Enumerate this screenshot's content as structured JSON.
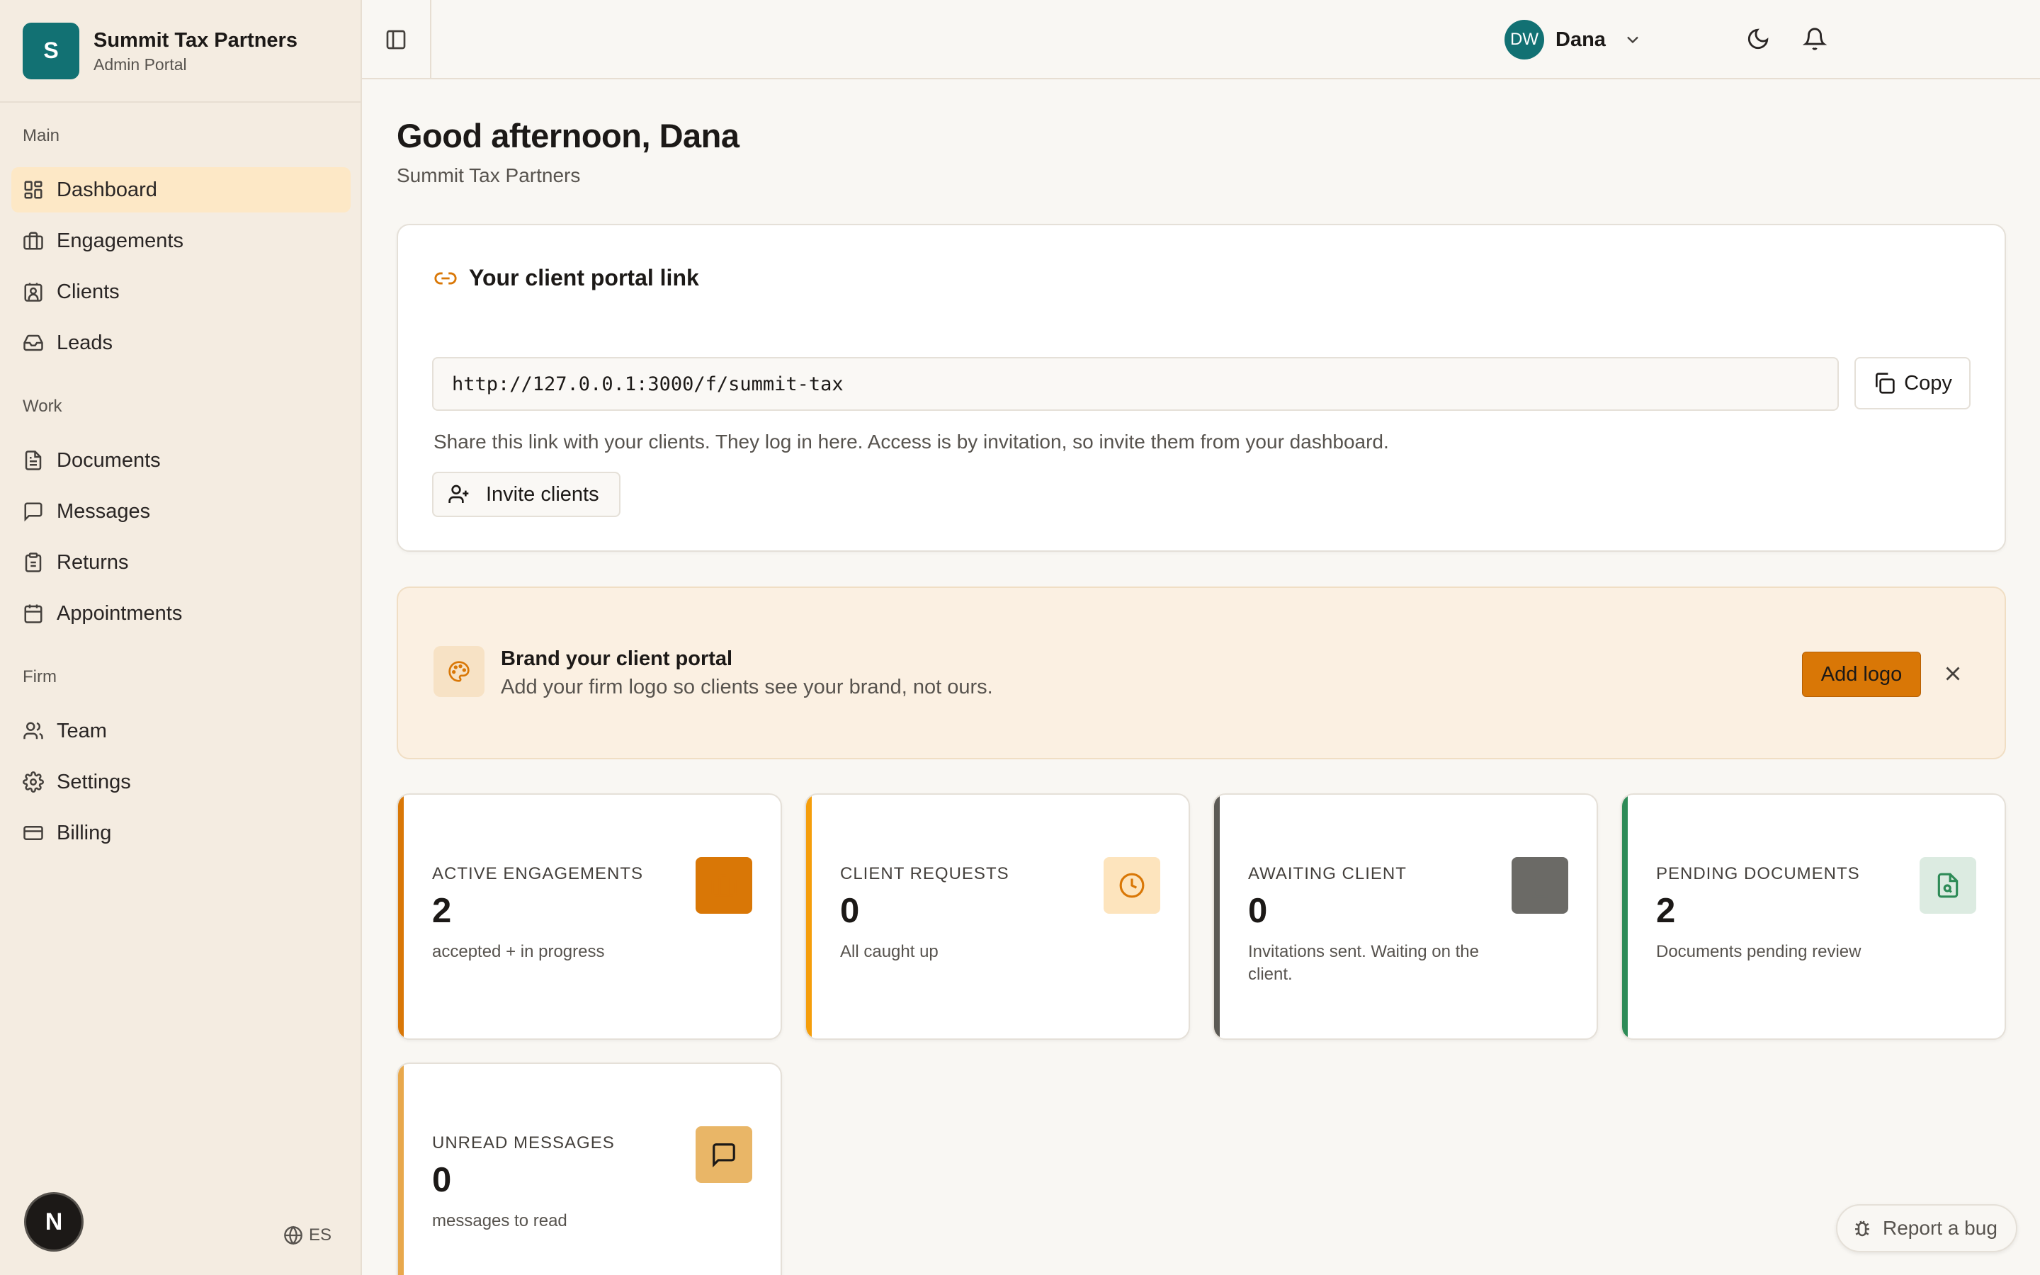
{
  "colors": {
    "accent": "#d97706",
    "brand": "#127173",
    "active_nav": "#fde8c6"
  },
  "brand": {
    "initial": "S",
    "name": "Summit Tax Partners",
    "subtitle": "Admin Portal"
  },
  "sidebar": {
    "sections": [
      {
        "label": "Main",
        "items": [
          {
            "label": "Dashboard",
            "icon": "dashboard-icon",
            "active": true
          },
          {
            "label": "Engagements",
            "icon": "briefcase-icon"
          },
          {
            "label": "Clients",
            "icon": "contact-icon"
          },
          {
            "label": "Leads",
            "icon": "inbox-icon"
          }
        ]
      },
      {
        "label": "Work",
        "items": [
          {
            "label": "Documents",
            "icon": "document-icon"
          },
          {
            "label": "Messages",
            "icon": "message-icon"
          },
          {
            "label": "Returns",
            "icon": "clipboard-icon"
          },
          {
            "label": "Appointments",
            "icon": "calendar-icon"
          }
        ]
      },
      {
        "label": "Firm",
        "items": [
          {
            "label": "Team",
            "icon": "users-icon"
          },
          {
            "label": "Settings",
            "icon": "gear-icon"
          },
          {
            "label": "Billing",
            "icon": "credit-card-icon"
          }
        ]
      }
    ],
    "language": "ES",
    "dev_badge": "N"
  },
  "topbar": {
    "user_initials": "DW",
    "user_name": "Dana"
  },
  "header": {
    "greeting": "Good afternoon, Dana",
    "firm": "Summit Tax Partners"
  },
  "portal": {
    "title": "Your client portal link",
    "url": "http://127.0.0.1:3000/f/summit-tax",
    "copy_label": "Copy",
    "help_text": "Share this link with your clients. They log in here. Access is by invitation, so invite them from your dashboard.",
    "invite_label": "Invite clients"
  },
  "branding": {
    "title": "Brand your client portal",
    "subtitle": "Add your firm logo so clients see your brand, not ours.",
    "button_label": "Add logo"
  },
  "stats": [
    {
      "label": "ACTIVE ENGAGEMENTS",
      "value": "2",
      "desc": "accepted + in progress",
      "bar_color": "#d97706",
      "icon": "briefcase-icon",
      "icon_bg": "#d97706",
      "icon_color": "#d97706"
    },
    {
      "label": "CLIENT REQUESTS",
      "value": "0",
      "desc": "All caught up",
      "bar_color": "#f59e0b",
      "icon": "clock-icon",
      "icon_bg": "#fde4bd",
      "icon_color": "#d97706"
    },
    {
      "label": "AWAITING CLIENT",
      "value": "0",
      "desc": "Invitations sent. Waiting on the client.",
      "bar_color": "#5c5a55",
      "icon": "hourglass-icon",
      "icon_bg": "#6b6a66",
      "icon_color": "#6b6a66"
    },
    {
      "label": "PENDING DOCUMENTS",
      "value": "2",
      "desc": "Documents pending review",
      "bar_color": "#2e8b57",
      "icon": "file-search-icon",
      "icon_bg": "#dcebe1",
      "icon_color": "#2e8b57"
    },
    {
      "label": "UNREAD MESSAGES",
      "value": "0",
      "desc": "messages to read",
      "bar_color": "#e8a84c",
      "icon": "message-icon",
      "icon_bg": "#e9b667",
      "icon_color": "#1c1917"
    }
  ],
  "report_bug": "Report a bug"
}
